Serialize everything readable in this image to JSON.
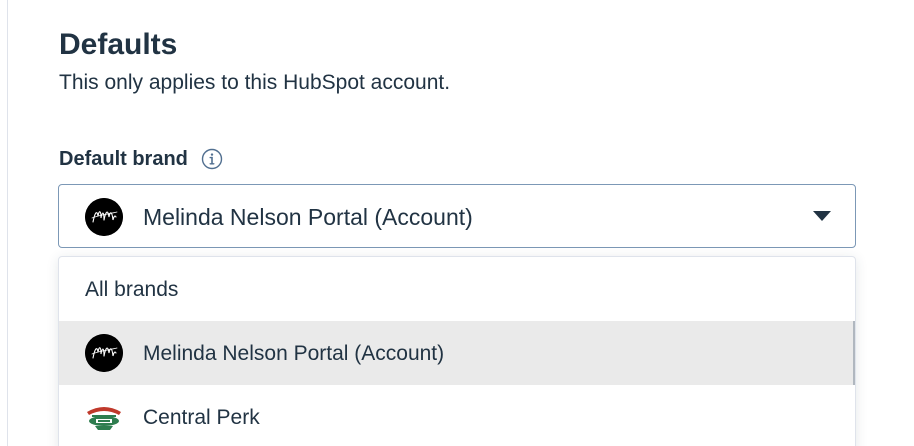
{
  "defaults": {
    "title": "Defaults",
    "description": "This only applies to this HubSpot account."
  },
  "default_brand": {
    "label": "Default brand",
    "info_icon": "info-icon",
    "selected_value": "Melinda Nelson Portal (Account)",
    "selected_avatar_initials": "MN",
    "dropdown_icon": "caret-down-icon"
  },
  "dropdown": {
    "options": [
      {
        "label": "All brands",
        "icon": "",
        "selected": false
      },
      {
        "label": "Melinda Nelson Portal (Account)",
        "icon": "mn-avatar-icon",
        "selected": true
      },
      {
        "label": "Central Perk",
        "icon": "central-perk-logo-icon",
        "selected": false
      }
    ]
  },
  "colors": {
    "text": "#213343",
    "border": "#7c98b6",
    "selected_bg": "#eaeaea",
    "avatar_bg": "#000000",
    "central_perk_green": "#2e7d4f",
    "central_perk_red": "#c0392b"
  }
}
